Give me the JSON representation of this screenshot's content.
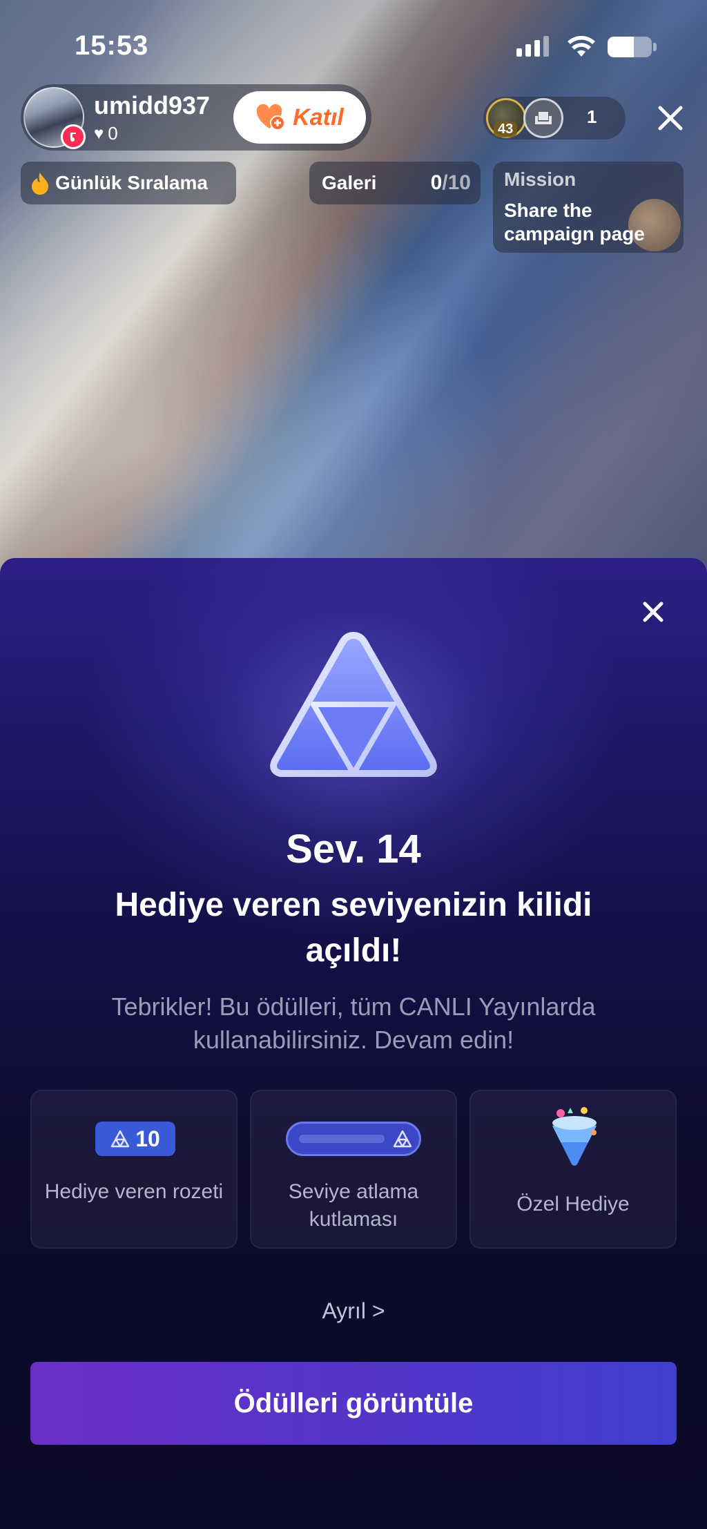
{
  "status_bar": {
    "time": "15:53",
    "battery_level": 0.6
  },
  "host": {
    "username": "umidd937",
    "likes": "0",
    "join_label": "Katıl"
  },
  "viewers": {
    "top_viewer_level": "43",
    "count": "1"
  },
  "chips": {
    "ranking_label": "Günlük Sıralama",
    "gallery_label": "Galeri",
    "gallery_current": "0",
    "gallery_total": "/10"
  },
  "mission": {
    "title": "Mission",
    "text": "Share the campaign page"
  },
  "sheet": {
    "level": "Sev. 14",
    "title": "Hediye veren seviyenizin kilidi açıldı!",
    "subtitle": "Tebrikler! Bu ödülleri, tüm CANLI Yayınlarda kullanabilirsiniz. Devam edin!",
    "rewards": [
      {
        "label": "Hediye veren rozeti",
        "badge_value": "10"
      },
      {
        "label": "Seviye atlama kutlaması"
      },
      {
        "label": "Özel Hediye"
      }
    ],
    "more_link": "Ayrıl >",
    "cta_label": "Ödülleri görüntüle"
  },
  "colors": {
    "accent_orange": "#ff6a2a",
    "cta_start": "#6a2fc7",
    "cta_end": "#3f3fd0",
    "badge_blue": "#3a5ad8"
  },
  "icons": [
    "wifi-icon",
    "battery-icon",
    "heart-icon",
    "join-heart-icon",
    "close-icon",
    "fire-icon",
    "triangle-badge-icon",
    "gift-cone-icon"
  ]
}
